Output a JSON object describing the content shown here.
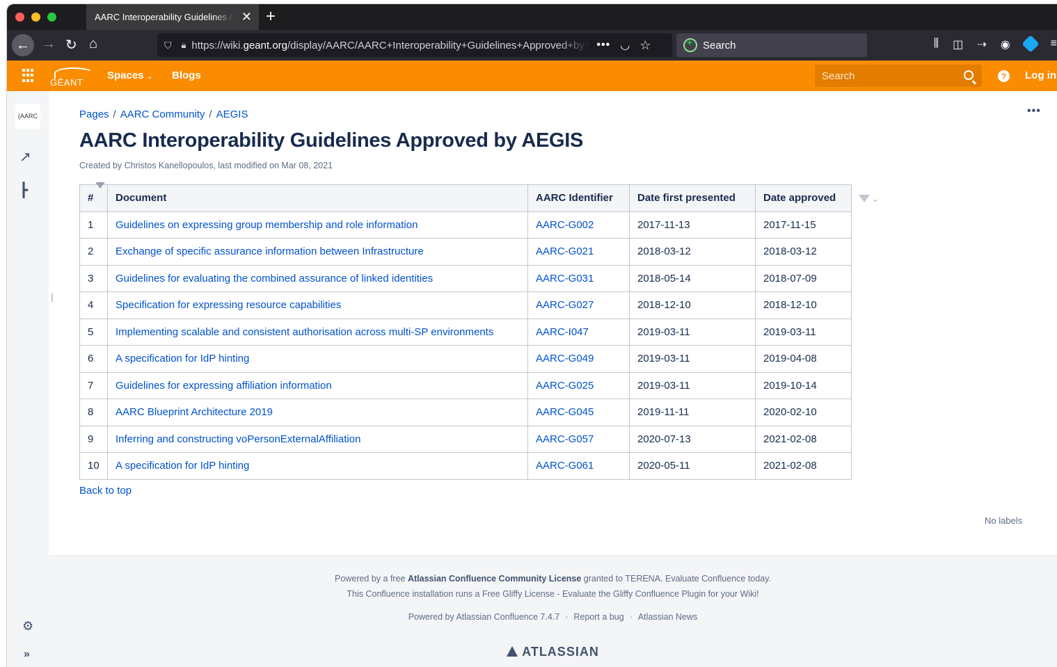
{
  "browser": {
    "tab_title": "AARC Interoperability Guidelines Approved by AEGIS",
    "url_prefix": "https://wiki.",
    "url_domain": "geant.org",
    "url_path": "/display/AARC/AARC+Interoperability+Guidelines+Approved+by+AEGIS",
    "search_placeholder": "Search"
  },
  "header": {
    "logo_text": "GÉANT",
    "spaces_label": "Spaces",
    "blogs_label": "Blogs",
    "search_placeholder": "Search",
    "login_label": "Log in"
  },
  "sidebar": {
    "space_logo_text": "AARC"
  },
  "page": {
    "breadcrumb": [
      "Pages",
      "AARC Community",
      "AEGIS"
    ],
    "title": "AARC Interoperability Guidelines Approved by AEGIS",
    "meta": "Created by Christos Kanellopoulos, last modified on Mar 08, 2021",
    "back_to_top": "Back to top",
    "no_labels": "No labels"
  },
  "table": {
    "headers": [
      "#",
      "Document",
      "AARC Identifier",
      "Date first presented",
      "Date approved"
    ],
    "rows": [
      [
        "1",
        "Guidelines on expressing group membership and role information",
        "AARC-G002",
        "2017-11-13",
        "2017-11-15"
      ],
      [
        "2",
        "Exchange of specific assurance information between Infrastructure",
        "AARC-G021",
        "2018-03-12",
        "2018-03-12"
      ],
      [
        "3",
        "Guidelines for evaluating the combined assurance of linked identities",
        "AARC-G031",
        "2018-05-14",
        "2018-07-09"
      ],
      [
        "4",
        "Specification for expressing resource capabilities",
        "AARC-G027",
        "2018-12-10",
        "2018-12-10"
      ],
      [
        "5",
        "Implementing scalable and consistent authorisation across multi-SP environments",
        "AARC-I047",
        "2019-03-11",
        "2019-03-11"
      ],
      [
        "6",
        "A specification for IdP hinting",
        "AARC-G049",
        "2019-03-11",
        "2019-04-08"
      ],
      [
        "7",
        "Guidelines for expressing affiliation information",
        "AARC-G025",
        "2019-03-11",
        "2019-10-14"
      ],
      [
        "8",
        "AARC Blueprint Architecture 2019",
        "AARC-G045",
        "2019-11-11",
        "2020-02-10"
      ],
      [
        "9",
        "Inferring and constructing voPersonExternalAffiliation",
        "AARC-G057",
        "2020-07-13",
        "2021-02-08"
      ],
      [
        "10",
        "A specification for IdP hinting",
        "AARC-G061",
        "2020-05-11",
        "2021-02-08"
      ]
    ]
  },
  "footer": {
    "line1_pre": "Powered by a free ",
    "line1_bold": "Atlassian Confluence Community License",
    "line1_post": " granted to TERENA. Evaluate Confluence today.",
    "line2": "This Confluence installation runs a Free Gliffy License - Evaluate the Gliffy Confluence Plugin for your Wiki!",
    "powered_by": "Powered by Atlassian Confluence 7.4.7",
    "report_bug": "Report a bug",
    "news": "Atlassian News",
    "atlassian_logo": "ATLASSIAN"
  },
  "colors": {
    "header_bg": "#fb8c00",
    "link": "#0052cc"
  }
}
